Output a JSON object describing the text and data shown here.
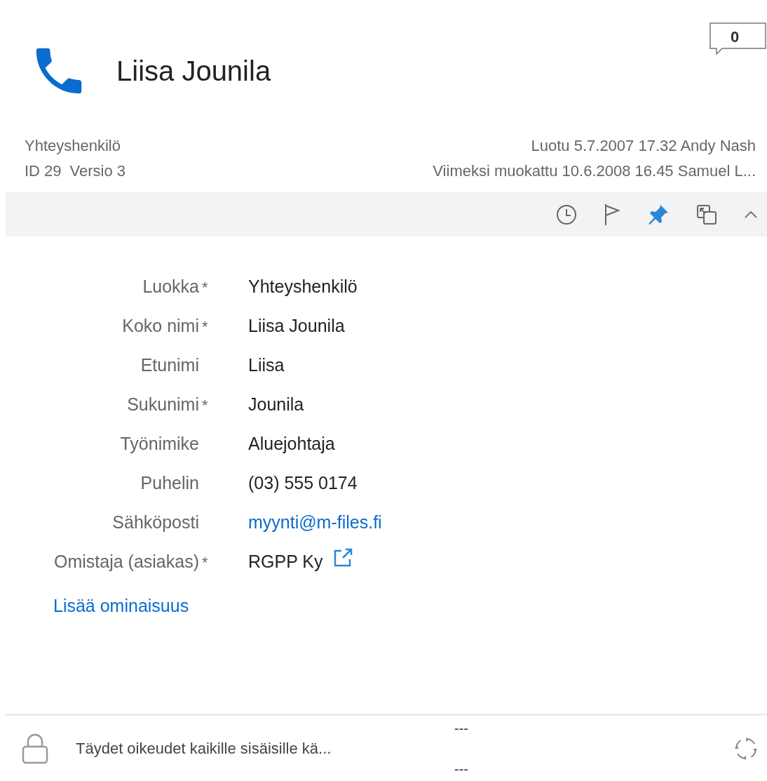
{
  "header": {
    "title": "Liisa Jounila",
    "comment_count": "0"
  },
  "meta": {
    "object_type": "Yhteyshenkilö",
    "id": "ID 29",
    "version": "Versio 3",
    "created": "Luotu 5.7.2007 17.32 Andy Nash",
    "modified": "Viimeksi muokattu 10.6.2008 16.45 Samuel L..."
  },
  "toolbar": {
    "pinned": true
  },
  "properties": [
    {
      "label": "Luokka",
      "required_mark": "*",
      "value": "Yhteyshenkilö",
      "kind": "text"
    },
    {
      "label": "Koko nimi",
      "required_mark": "*",
      "value": "Liisa Jounila",
      "kind": "text"
    },
    {
      "label": "Etunimi",
      "value": "Liisa",
      "kind": "text"
    },
    {
      "label": "Sukunimi",
      "required_mark": "*",
      "value": "Jounila",
      "kind": "text"
    },
    {
      "label": "Työnimike",
      "value": "Aluejohtaja",
      "kind": "text"
    },
    {
      "label": "Puhelin",
      "value": "(03) 555 0174",
      "kind": "text"
    },
    {
      "label": "Sähköposti",
      "value": "myynti@m-files.fi",
      "kind": "link"
    },
    {
      "label": "Omistaja (asiakas)",
      "required_mark": "*",
      "value": "RGPP Ky",
      "kind": "lookup"
    }
  ],
  "add_property": "Lisää ominaisuus",
  "footer": {
    "permissions": "Täydet oikeudet kaikille sisäisille kä...",
    "workflow": "---",
    "state": "---"
  }
}
